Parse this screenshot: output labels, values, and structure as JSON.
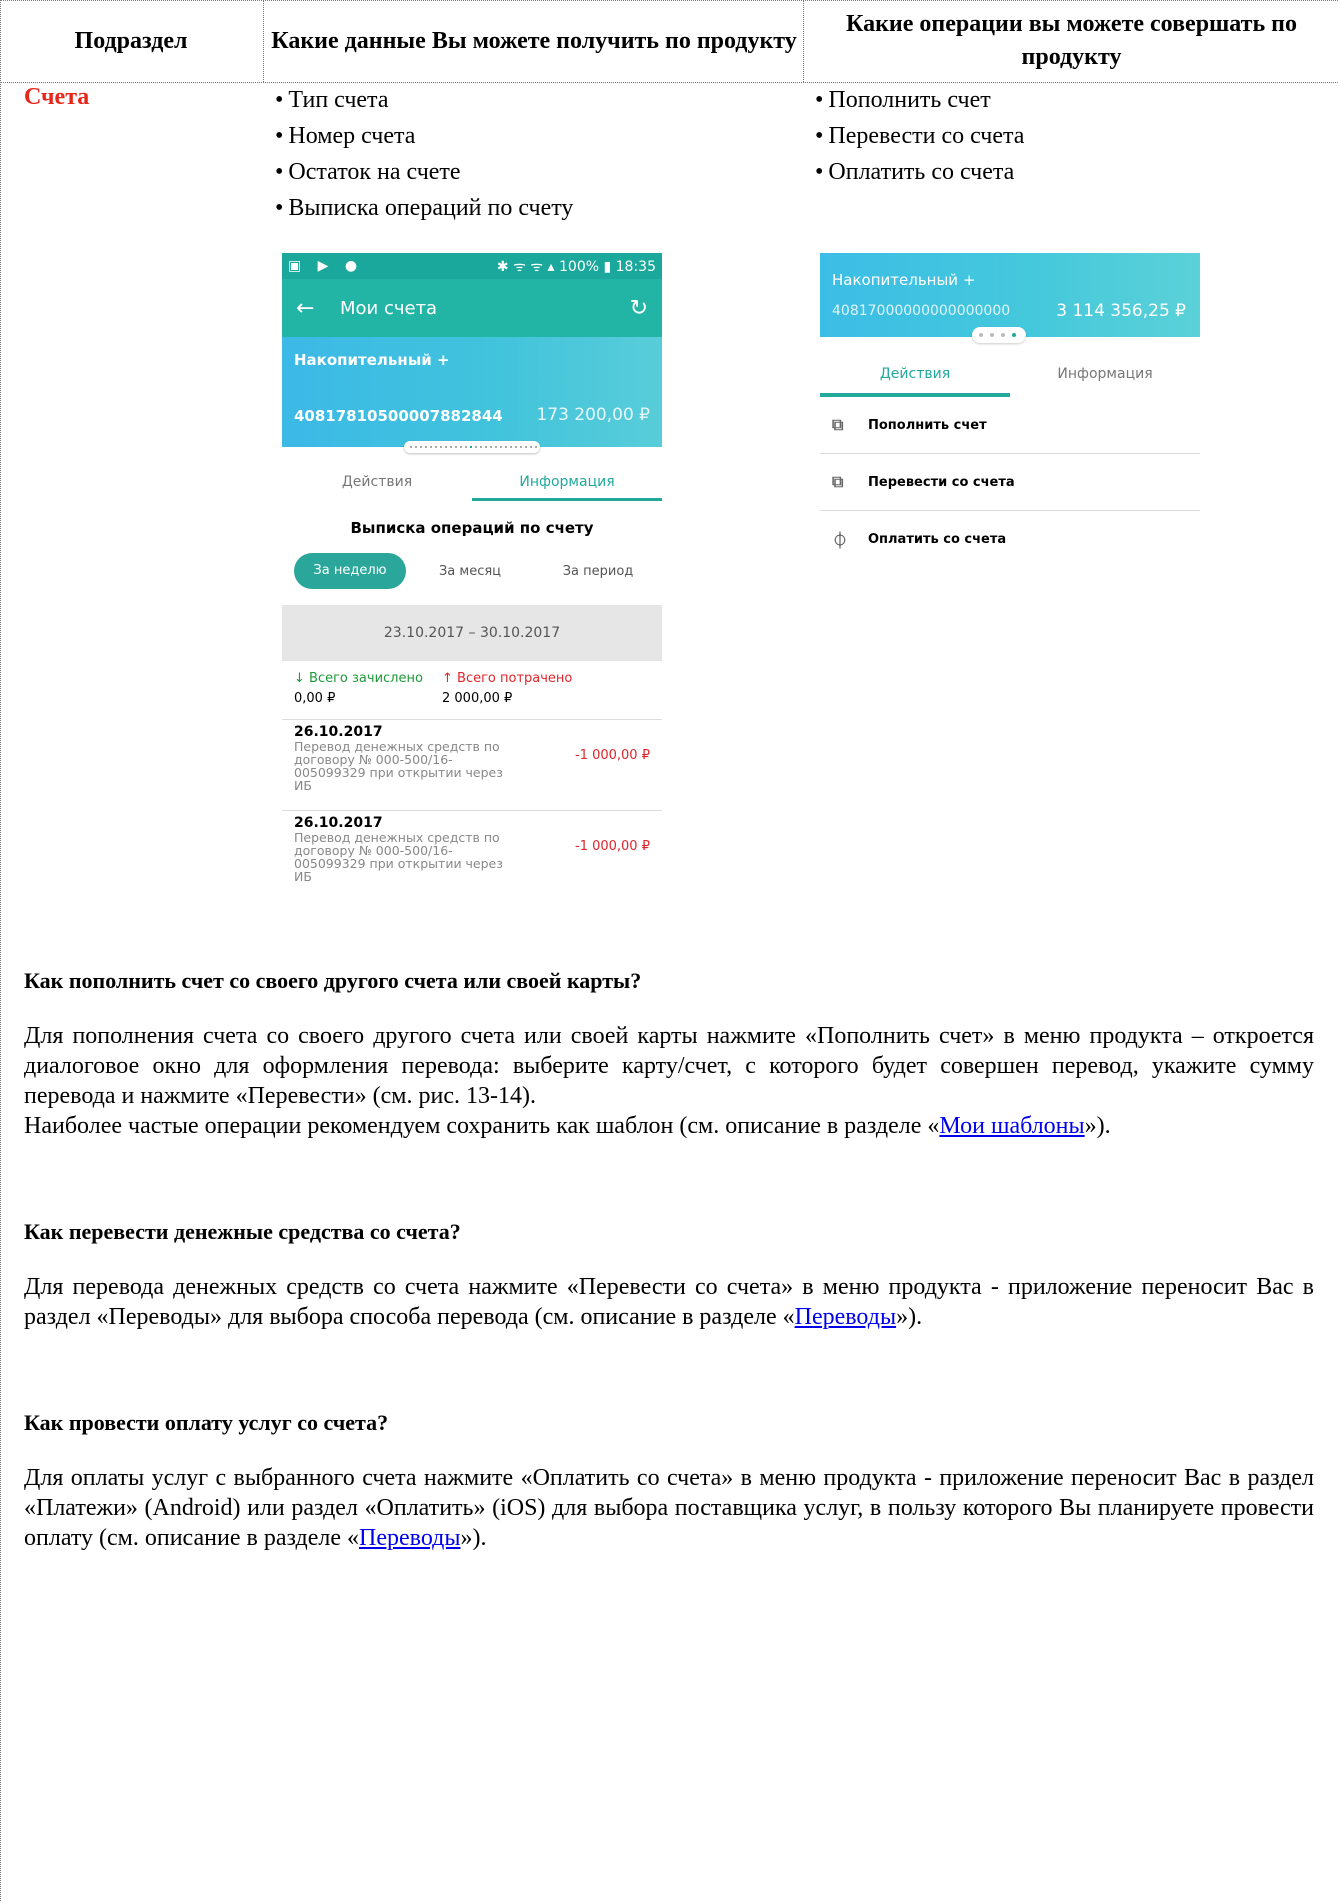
{
  "table": {
    "headers": [
      "Подраздел",
      "Какие данные Вы можете получить по продукту",
      "Какие операции вы можете совершать по продукту"
    ],
    "section_label": "Счета",
    "data_items": [
      "Тип счета",
      "Номер счета",
      "Остаток на счете",
      "Выписка операций по счету"
    ],
    "operation_items": [
      "Пополнить счет",
      "Перевести со счета",
      "Оплатить со счета"
    ]
  },
  "screen1": {
    "status_left": "▣ ▶ ●",
    "status_right": "✱ ᯤ ᯤ ▴ 100% ▮ 18:35",
    "back_icon": "←",
    "title": "Мои счета",
    "refresh_icon": "↻",
    "card_name": "Накопительный +",
    "card_number": "40817810500007882844",
    "card_amount": "173 200,00 ₽",
    "tab_actions": "Действия",
    "tab_info": "Информация",
    "subtitle": "Выписка операций по счету",
    "period_week": "За неделю",
    "period_month": "За месяц",
    "period_range": "За период",
    "date_range": "23.10.2017 – 30.10.2017",
    "credited_label": "↓ Всего зачислено",
    "credited_value": "0,00 ₽",
    "spent_label": "↑ Всего потрачено",
    "spent_value": "2 000,00 ₽",
    "operations": [
      {
        "date": "26.10.2017",
        "text": "Перевод денежных средств по договору № 000-500/16-005099329 при открытии через ИБ",
        "amount": "-1 000,00 ₽"
      },
      {
        "date": "26.10.2017",
        "text": "Перевод денежных средств по договору № 000-500/16-005099329 при открытии через ИБ",
        "amount": "-1 000,00 ₽"
      }
    ]
  },
  "screen2": {
    "card_name": "Накопительный +",
    "card_number": "40817000000000000000",
    "card_amount": "3 114 356,25 ₽",
    "tab_actions": "Действия",
    "tab_info": "Информация",
    "actions": [
      {
        "icon": "card-topup-icon",
        "glyph": "⧉",
        "label": "Пополнить счет"
      },
      {
        "icon": "card-transfer-icon",
        "glyph": "⧉",
        "label": "Перевести со счета"
      },
      {
        "icon": "pay-bill-icon",
        "glyph": "⏀",
        "label": "Оплатить со счета"
      }
    ]
  },
  "faq": [
    {
      "question": "Как пополнить счет со своего другого счета или своей карты?",
      "p1": "Для пополнения счета со своего другого счета или своей карты нажмите «Пополнить счет» в меню продукта – откроется диалоговое окно для оформления перевода: выберите карту/счет, с которого будет совершен перевод, укажите сумму перевода и нажмите «Перевести» (см. рис. 13-14).",
      "p2_before": "Наиболее частые операции рекомендуем сохранить как шаблон (см. описание в разделе «",
      "p2_link": "Мои шаблоны",
      "p2_after": "»)."
    },
    {
      "question": "Как перевести денежные средства со счета?",
      "before": "Для перевода денежных средств со счета нажмите «Перевести со счета» в меню продукта - приложение переносит Вас в раздел «Переводы» для выбора способа перевода (см. описание в разделе «",
      "link": "Переводы",
      "after": "»)."
    },
    {
      "question": "Как провести оплату услуг со счета?",
      "before": "Для оплаты услуг с выбранного счета нажмите «Оплатить со счета» в меню продукта - приложение переносит Вас в раздел «Платежи» (Android) или раздел «Оплатить» (iOS) для выбора поставщика услуг, в пользу которого Вы планируете провести оплату (см. описание в разделе «",
      "link": "Переводы",
      "after": "»)."
    }
  ]
}
